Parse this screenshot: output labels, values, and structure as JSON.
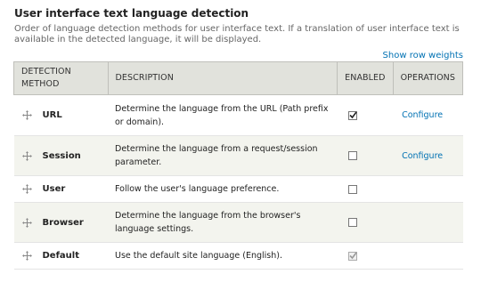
{
  "section": {
    "title": "User interface text language detection",
    "description": "Order of language detection methods for user interface text. If a translation of user interface text is available in the detected language, it will be displayed."
  },
  "row_weights_link": "Show row weights",
  "table": {
    "headers": {
      "method": "DETECTION METHOD",
      "description": "DESCRIPTION",
      "enabled": "ENABLED",
      "operations": "OPERATIONS"
    },
    "rows": [
      {
        "name": "URL",
        "description": "Determine the language from the URL (Path prefix or domain).",
        "enabled": true,
        "disabled": false,
        "operation": "Configure"
      },
      {
        "name": "Session",
        "description": "Determine the language from a request/session parameter.",
        "enabled": false,
        "disabled": false,
        "operation": "Configure"
      },
      {
        "name": "User",
        "description": "Follow the user's language preference.",
        "enabled": false,
        "disabled": false,
        "operation": ""
      },
      {
        "name": "Browser",
        "description": "Determine the language from the browser's language settings.",
        "enabled": false,
        "disabled": false,
        "operation": ""
      },
      {
        "name": "Default",
        "description": "Use the default site language (English).",
        "enabled": true,
        "disabled": true,
        "operation": ""
      }
    ]
  },
  "icons": {
    "drag_handle": "move-cross-icon",
    "checkbox_check": "checkmark-icon"
  },
  "colors": {
    "link": "#0071b3",
    "header_bg": "#e1e2dc",
    "stripe_bg": "#f3f4ee"
  }
}
